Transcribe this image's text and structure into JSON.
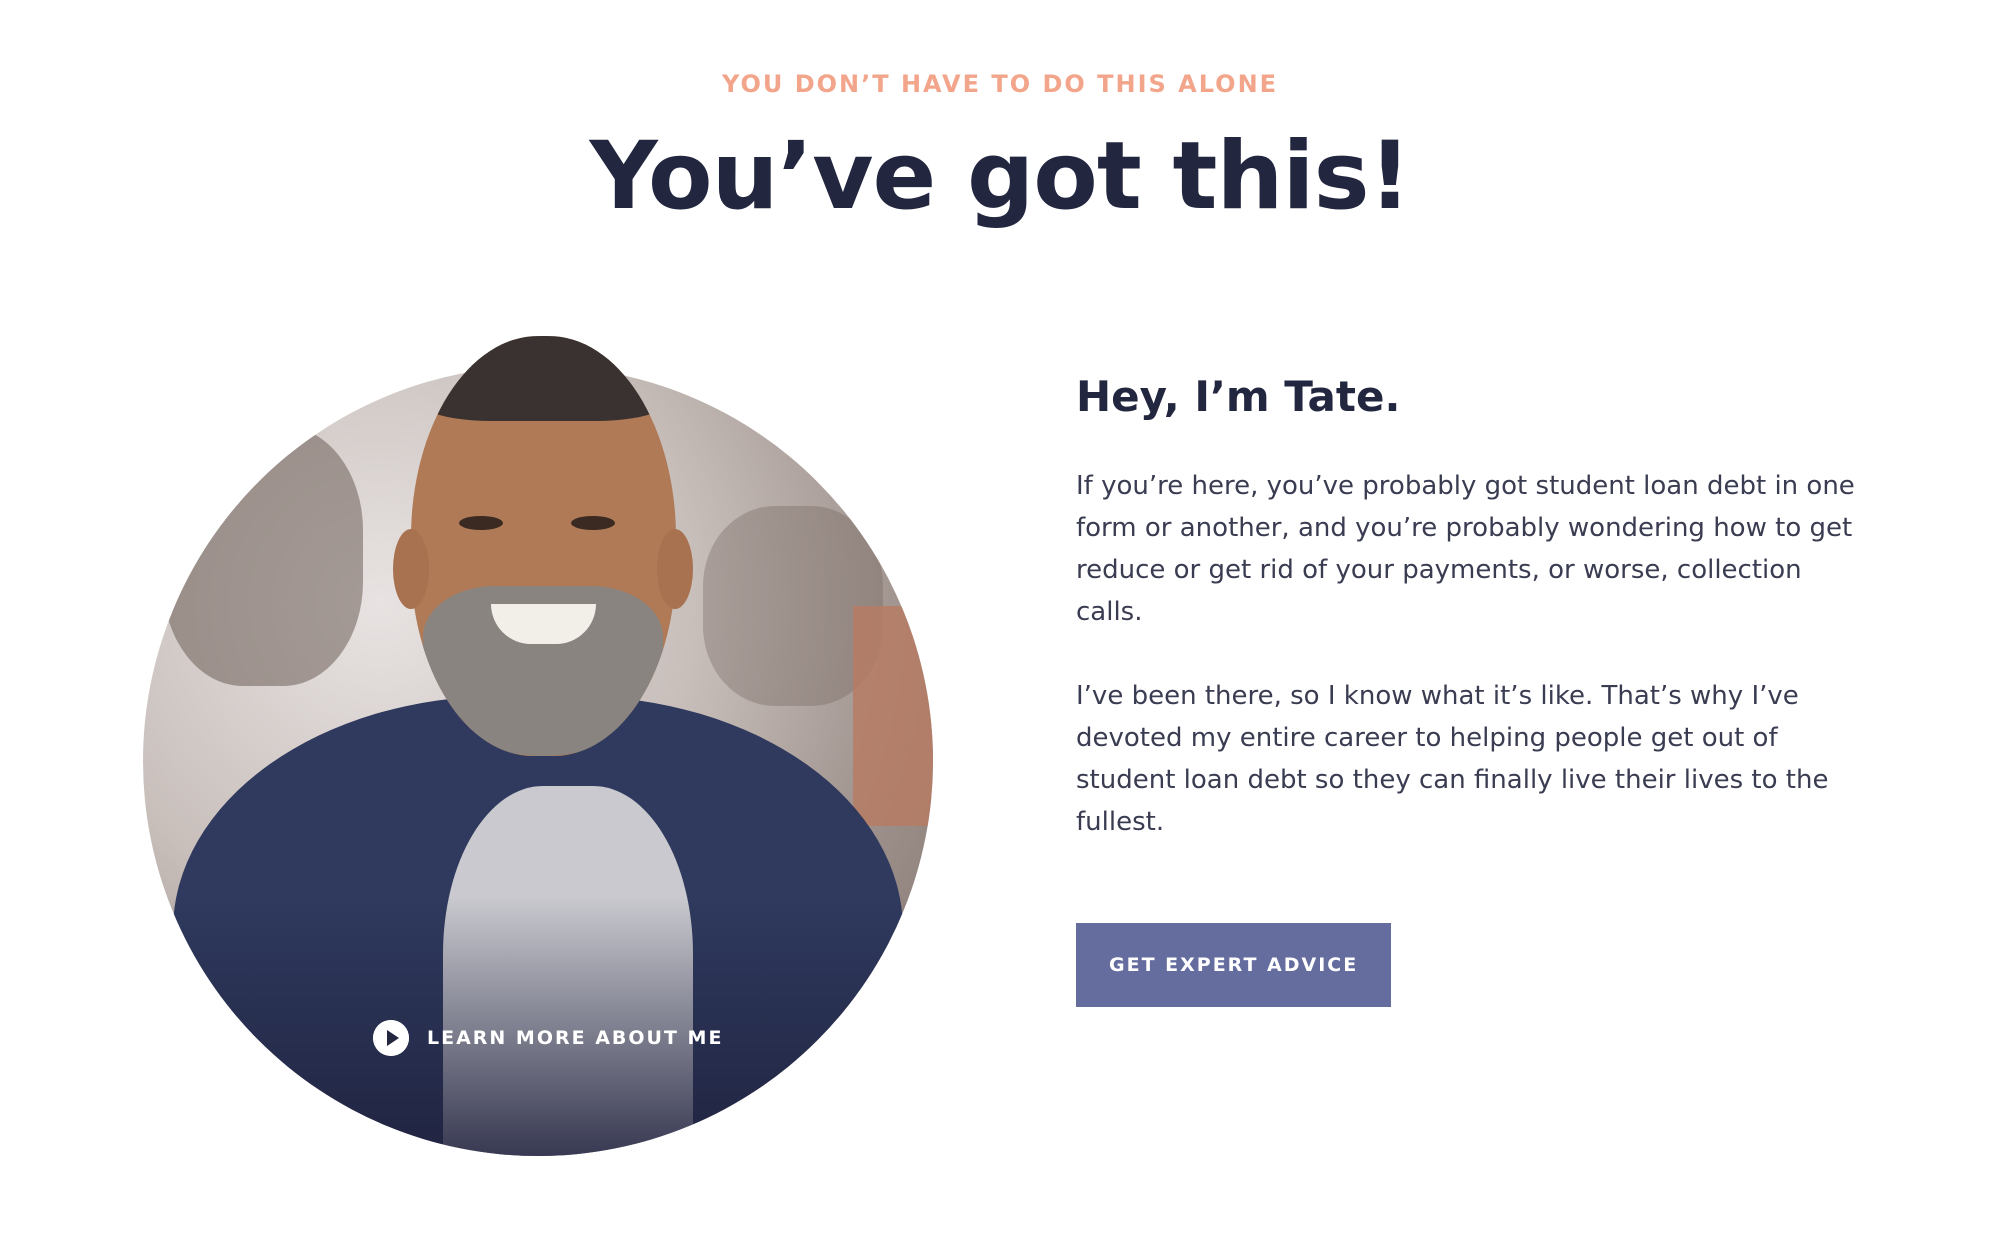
{
  "header": {
    "eyebrow": "YOU DON’T HAVE TO DO THIS ALONE",
    "headline": "You’ve got this!"
  },
  "photo": {
    "learn_more_label": "LEARN MORE ABOUT ME"
  },
  "intro": {
    "title": "Hey, I’m Tate.",
    "paragraph_1": "If you’re here, you’ve probably got student loan debt in one form or another, and you’re probably wondering how to get reduce or get rid of your payments, or worse, collection calls.",
    "paragraph_2": "I’ve been there, so I know what it’s like. That’s why I’ve devoted my entire career to helping people get out of student loan debt so they can finally live their lives to the fullest.",
    "cta_label": "GET EXPERT ADVICE"
  },
  "colors": {
    "eyebrow": "#f2a58a",
    "headline": "#22263f",
    "button": "#656d9f"
  },
  "icons": {
    "play": "play-icon"
  }
}
